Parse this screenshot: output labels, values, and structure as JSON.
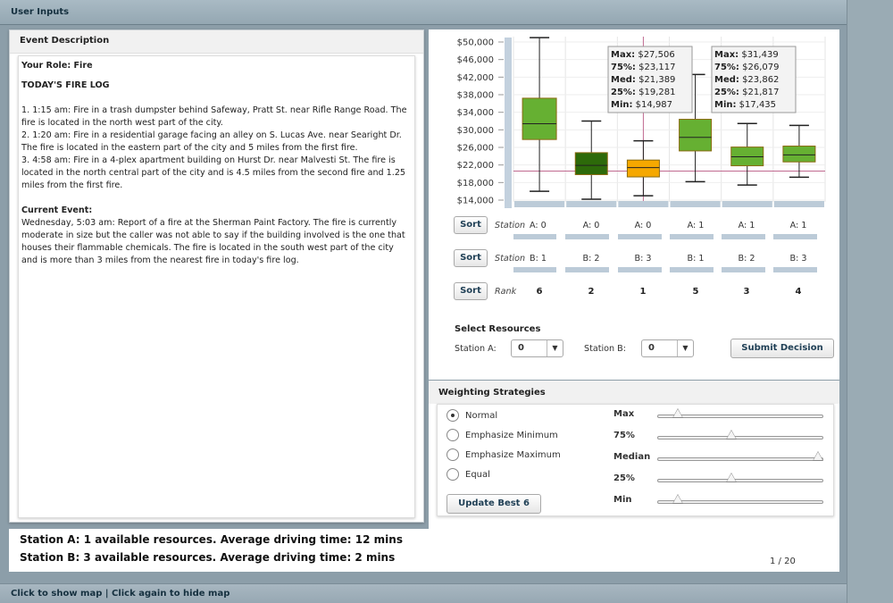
{
  "window": {
    "title": "User Inputs"
  },
  "event": {
    "header": "Event Description",
    "role": "Your Role: Fire",
    "log_title": "TODAY'S FIRE LOG",
    "log_items": [
      "1. 1:15 am: Fire in a trash dumpster behind Safeway, Pratt St. near Rifle Range Road. The fire is located in the north west part of the city.",
      "2. 1:20 am: Fire in a residential garage facing an alley on S. Lucas Ave. near Searight Dr. The fire is located in the eastern part of the city and 5 miles from the first fire.",
      "3. 4:58 am: Fire in a 4-plex apartment building on Hurst Dr. near Malvesti St. The fire is located in the north central part of the city and is 4.5 miles from the second fire and 1.25 miles from the first fire."
    ],
    "current_title": "Current Event:",
    "current_text": "Wednesday, 5:03 am:  Report of a fire at the Sherman Paint Factory.  The fire is currently moderate in size but the caller was not able to say if the building involved is the one that houses their flammable chemicals. The fire is located in the south west part of the city and is more than 3 miles from the nearest fire in today's fire log."
  },
  "chart_data": {
    "type": "boxplot",
    "y_ticks": [
      "$14,000",
      "$18,000",
      "$22,000",
      "$26,000",
      "$30,000",
      "$34,000",
      "$38,000",
      "$42,000",
      "$46,000",
      "$50,000"
    ],
    "ylim": [
      14000,
      50000
    ],
    "reference_line": 20600,
    "boxes": [
      {
        "min": 16000,
        "q1": 27800,
        "median": 31400,
        "q3": 37200,
        "max": 51000,
        "color": "#66b032"
      },
      {
        "min": 14200,
        "q1": 19800,
        "median": 21900,
        "q3": 24800,
        "max": 32000,
        "color": "#2d6a0a"
      },
      {
        "min": 14987,
        "q1": 19281,
        "median": 21389,
        "q3": 23117,
        "max": 27506,
        "color": "#f5a800"
      },
      {
        "min": 18200,
        "q1": 25200,
        "median": 28300,
        "q3": 32400,
        "max": 42600,
        "color": "#66b032"
      },
      {
        "min": 17435,
        "q1": 21817,
        "median": 23862,
        "q3": 26079,
        "max": 31439,
        "color": "#66b032"
      },
      {
        "min": 19200,
        "q1": 22700,
        "median": 24300,
        "q3": 26300,
        "max": 31000,
        "color": "#66b032"
      }
    ],
    "tooltips": [
      {
        "box": 2,
        "lines": [
          "Max: $27,506",
          "75%: $23,117",
          "Med: $21,389",
          "25%: $19,281",
          "Min: $14,987"
        ]
      },
      {
        "box": 4,
        "lines": [
          "Max: $31,439",
          "75%: $26,079",
          "Med: $23,862",
          "25%: $21,817",
          "Min: $17,435"
        ]
      }
    ]
  },
  "table": {
    "sort_label": "Sort",
    "station_a_label": "Station",
    "station_a_prefix": "A: 0",
    "station_a": [
      "A: 0",
      "A: 0",
      "A: 1",
      "A: 1",
      "A: 1"
    ],
    "station_b_label": "Station",
    "station_b_prefix": "B: 1",
    "station_b": [
      "B: 2",
      "B: 3",
      "B: 1",
      "B: 2",
      "B: 3"
    ],
    "rank_label": "Rank",
    "ranks": [
      "6",
      "2",
      "1",
      "5",
      "3",
      "4"
    ]
  },
  "resources": {
    "title": "Select Resources",
    "station_a_label": "Station A:",
    "station_a_value": "0",
    "station_b_label": "Station B:",
    "station_b_value": "0",
    "submit_label": "Submit Decision"
  },
  "weighting": {
    "title": "Weighting Strategies",
    "options": [
      "Normal",
      "Emphasize Minimum",
      "Emphasize Maximum",
      "Equal"
    ],
    "selected": 0,
    "update_label": "Update Best 6",
    "sliders": [
      {
        "label": "Max",
        "value": 0.1
      },
      {
        "label": "75%",
        "value": 0.44
      },
      {
        "label": "Median",
        "value": 1.0
      },
      {
        "label": "25%",
        "value": 0.44
      },
      {
        "label": "Min",
        "value": 0.1
      }
    ]
  },
  "status": {
    "station_a": "Station A: 1 available resources. Average driving time: 12 mins",
    "station_b": "Station B: 3 available resources. Average driving time: 2 mins",
    "pager": "1  / 20"
  },
  "footer": {
    "map_toggle": "Click to show map | Click again to hide map"
  }
}
